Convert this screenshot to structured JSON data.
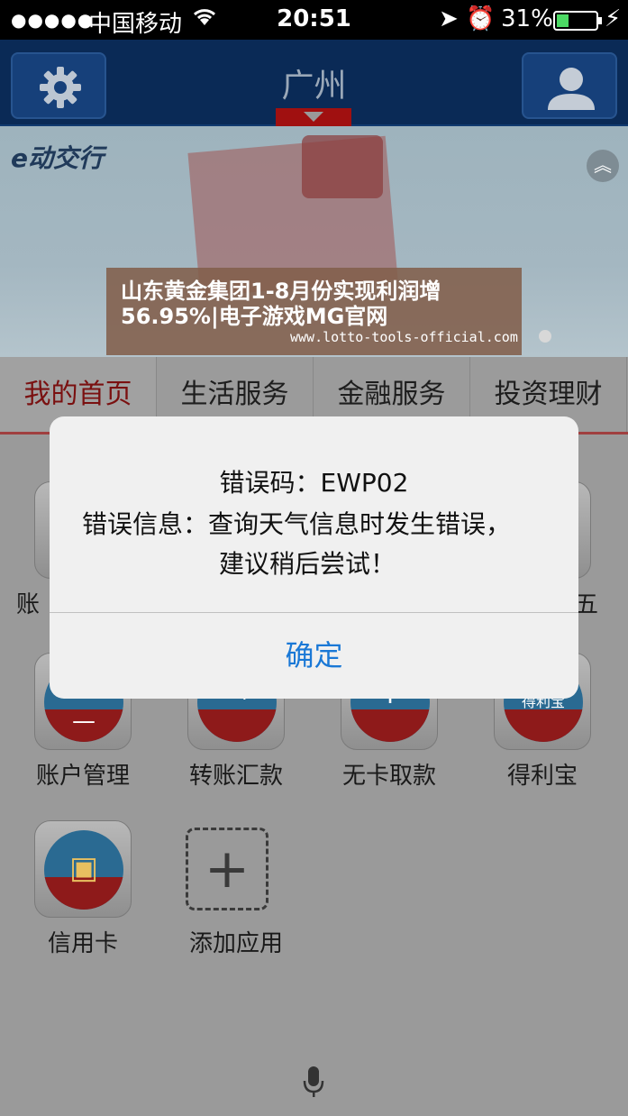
{
  "status_bar": {
    "signal": "●●●●●",
    "carrier": "中国移动",
    "wifi_icon": "wifi-icon",
    "time": "20:51",
    "battery_percent": "31%",
    "battery_level": 0.31,
    "charge_glyph": "⚡"
  },
  "nav": {
    "title": "广州",
    "settings_icon": "gear-icon",
    "profile_icon": "user-icon"
  },
  "banner": {
    "logo_text": "e动交行",
    "headline": "山东黄金集团1-8月份实现利润增56.95%|电子游戏MG官网",
    "url": "www.lotto-tools-official.com",
    "collapse_glyph": "︽"
  },
  "tabs": [
    {
      "label": "我的首页"
    },
    {
      "label": "生活服务"
    },
    {
      "label": "金融服务"
    },
    {
      "label": "投资理财"
    }
  ],
  "apps_row1": [
    {
      "label": "账"
    },
    {
      "label": "五"
    }
  ],
  "apps_row2": [
    {
      "label": "账户管理",
      "glyph": "—"
    },
    {
      "label": "转账汇款",
      "glyph": "→¥"
    },
    {
      "label": "无卡取款",
      "glyph": "¥"
    },
    {
      "label": "得利宝",
      "glyph": "得利宝"
    }
  ],
  "apps_row3": [
    {
      "label": "信用卡",
      "glyph": "▣"
    },
    {
      "label": "添加应用",
      "glyph": "+"
    }
  ],
  "dialog": {
    "code_line": "错误码：EWP02",
    "info_line": "错误信息：查询天气信息时发生错误，",
    "advice_line": "建议稍后尝试！",
    "ok_label": "确定"
  },
  "colors": {
    "nav_bg": "#0a2a56",
    "active_tab_text": "#7a1010",
    "ok_blue": "#1a78d6"
  }
}
